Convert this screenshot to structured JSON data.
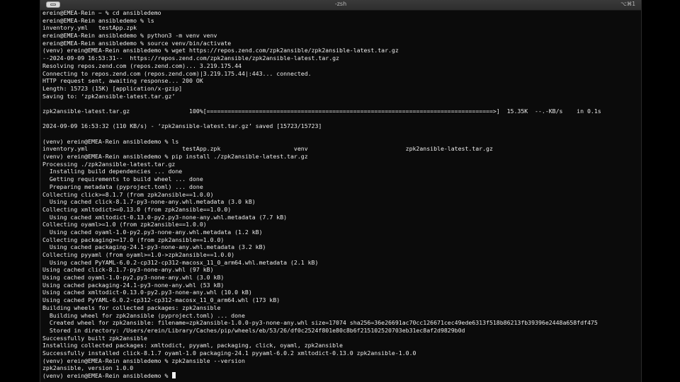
{
  "window": {
    "title": "-zsh",
    "shortcut": "⌥⌘1"
  },
  "terminal": {
    "lines": [
      "erein@EMEA-Rein ~ % cd ansibledemo",
      "erein@EMEA-Rein ansibledemo % ls",
      "inventory.yml   testApp.zpk",
      "erein@EMEA-Rein ansibledemo % python3 -m venv venv",
      "erein@EMEA-Rein ansibledemo % source venv/bin/activate",
      "(venv) erein@EMEA-Rein ansibledemo % wget https://repos.zend.com/zpk2ansible/zpk2ansible-latest.tar.gz",
      "--2024-09-09 16:53:31--  https://repos.zend.com/zpk2ansible/zpk2ansible-latest.tar.gz",
      "Resolving repos.zend.com (repos.zend.com)... 3.219.175.44",
      "Connecting to repos.zend.com (repos.zend.com)|3.219.175.44|:443... connected.",
      "HTTP request sent, awaiting response... 200 OK",
      "Length: 15723 (15K) [application/x-gzip]",
      "Saving to: ‘zpk2ansible-latest.tar.gz’",
      "",
      "zpk2ansible-latest.tar.gz                 100%[==================================================================================>]  15.35K  --.-KB/s    in 0.1s",
      "",
      "2024-09-09 16:53:32 (110 KB/s) - ‘zpk2ansible-latest.tar.gz’ saved [15723/15723]",
      "",
      "(venv) erein@EMEA-Rein ansibledemo % ls",
      "inventory.yml                           testApp.zpk                     venv                            zpk2ansible-latest.tar.gz",
      "(venv) erein@EMEA-Rein ansibledemo % pip install ./zpk2ansible-latest.tar.gz",
      "Processing ./zpk2ansible-latest.tar.gz",
      "  Installing build dependencies ... done",
      "  Getting requirements to build wheel ... done",
      "  Preparing metadata (pyproject.toml) ... done",
      "Collecting click>=8.1.7 (from zpk2ansible==1.0.0)",
      "  Using cached click-8.1.7-py3-none-any.whl.metadata (3.0 kB)",
      "Collecting xmltodict>=0.13.0 (from zpk2ansible==1.0.0)",
      "  Using cached xmltodict-0.13.0-py2.py3-none-any.whl.metadata (7.7 kB)",
      "Collecting oyaml>=1.0 (from zpk2ansible==1.0.0)",
      "  Using cached oyaml-1.0-py2.py3-none-any.whl.metadata (1.2 kB)",
      "Collecting packaging>=17.0 (from zpk2ansible==1.0.0)",
      "  Using cached packaging-24.1-py3-none-any.whl.metadata (3.2 kB)",
      "Collecting pyyaml (from oyaml>=1.0->zpk2ansible==1.0.0)",
      "  Using cached PyYAML-6.0.2-cp312-cp312-macosx_11_0_arm64.whl.metadata (2.1 kB)",
      "Using cached click-8.1.7-py3-none-any.whl (97 kB)",
      "Using cached oyaml-1.0-py2.py3-none-any.whl (3.0 kB)",
      "Using cached packaging-24.1-py3-none-any.whl (53 kB)",
      "Using cached xmltodict-0.13.0-py2.py3-none-any.whl (10.0 kB)",
      "Using cached PyYAML-6.0.2-cp312-cp312-macosx_11_0_arm64.whl (173 kB)",
      "Building wheels for collected packages: zpk2ansible",
      "  Building wheel for zpk2ansible (pyproject.toml) ... done",
      "  Created wheel for zpk2ansible: filename=zpk2ansible-1.0.0-py3-none-any.whl size=17074 sha256=36e26691ac70cc126671cec49ede6313f518b86213fb39396e2448a658fdf475",
      "  Stored in directory: /Users/erein/Library/Caches/pip/wheels/eb/53/26/df0c2524f801e80c8b6f215102520703eb31ec8af2d9829b0d",
      "Successfully built zpk2ansible",
      "Installing collected packages: xmltodict, pyyaml, packaging, click, oyaml, zpk2ansible",
      "Successfully installed click-8.1.7 oyaml-1.0 packaging-24.1 pyyaml-6.0.2 xmltodict-0.13.0 zpk2ansible-1.0.0",
      "(venv) erein@EMEA-Rein ansibledemo % zpk2ansible --version",
      "zpk2ansible, version 1.0.0",
      "(venv) erein@EMEA-Rein ansibledemo % "
    ]
  }
}
